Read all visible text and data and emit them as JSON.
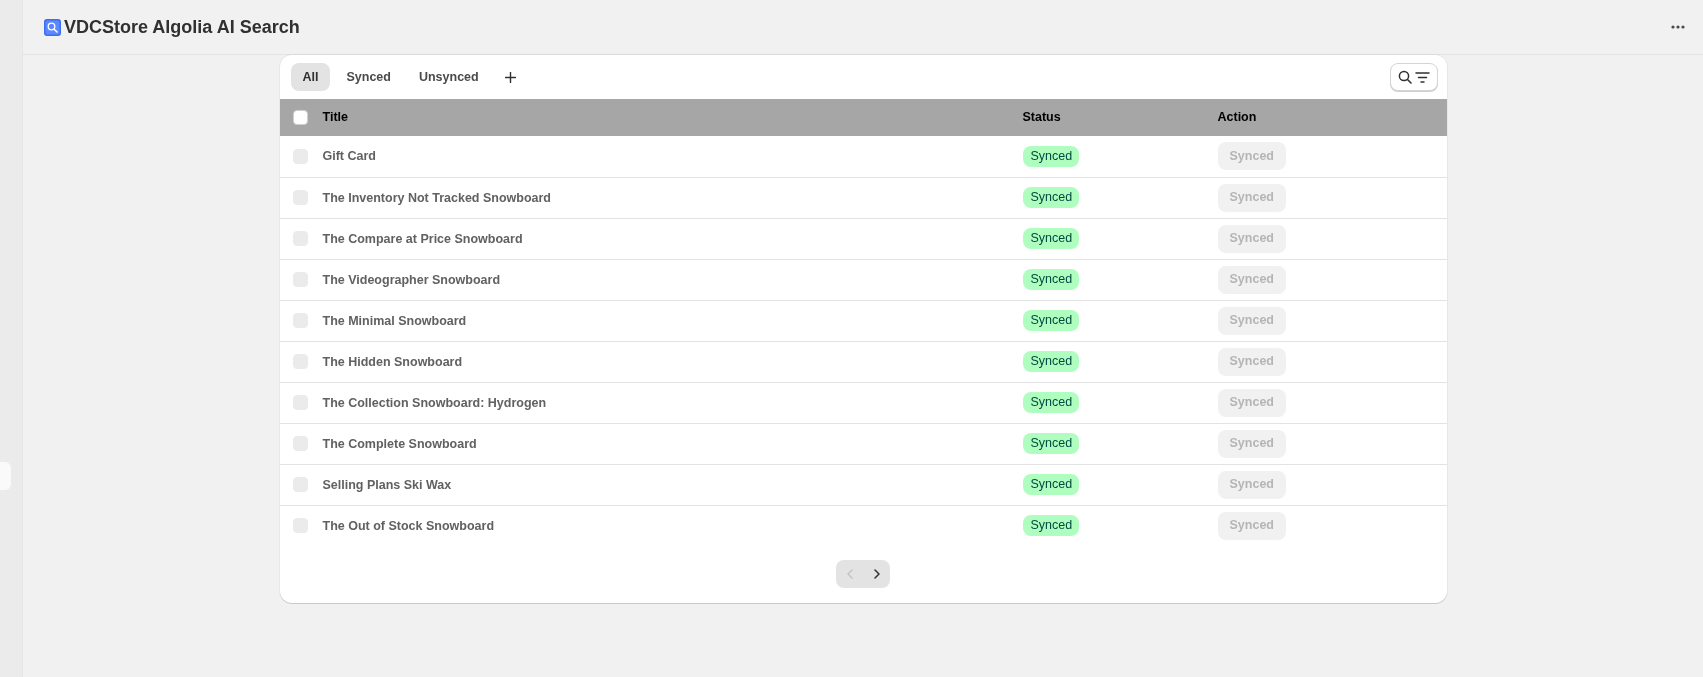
{
  "app": {
    "title": "VDCStore Algolia AI Search"
  },
  "tabs": [
    {
      "label": "All",
      "selected": true
    },
    {
      "label": "Synced",
      "selected": false
    },
    {
      "label": "Unsynced",
      "selected": false
    }
  ],
  "table": {
    "select_all": {
      "checked": false
    },
    "columns": [
      "Title",
      "Status",
      "Action"
    ],
    "rows": [
      {
        "checkbox": {
          "checked": false,
          "disabled": true
        },
        "title": "Gift Card",
        "status": "Synced",
        "action": {
          "label": "Synced",
          "disabled": true
        }
      },
      {
        "checkbox": {
          "checked": false,
          "disabled": true
        },
        "title": "The Inventory Not Tracked Snowboard",
        "status": "Synced",
        "action": {
          "label": "Synced",
          "disabled": true
        }
      },
      {
        "checkbox": {
          "checked": false,
          "disabled": true
        },
        "title": "The Compare at Price Snowboard",
        "status": "Synced",
        "action": {
          "label": "Synced",
          "disabled": true
        }
      },
      {
        "checkbox": {
          "checked": false,
          "disabled": true
        },
        "title": "The Videographer Snowboard",
        "status": "Synced",
        "action": {
          "label": "Synced",
          "disabled": true
        }
      },
      {
        "checkbox": {
          "checked": false,
          "disabled": true
        },
        "title": "The Minimal Snowboard",
        "status": "Synced",
        "action": {
          "label": "Synced",
          "disabled": true
        }
      },
      {
        "checkbox": {
          "checked": false,
          "disabled": true
        },
        "title": "The Hidden Snowboard",
        "status": "Synced",
        "action": {
          "label": "Synced",
          "disabled": true
        }
      },
      {
        "checkbox": {
          "checked": false,
          "disabled": true
        },
        "title": "The Collection Snowboard: Hydrogen",
        "status": "Synced",
        "action": {
          "label": "Synced",
          "disabled": true
        }
      },
      {
        "checkbox": {
          "checked": false,
          "disabled": true
        },
        "title": "The Complete Snowboard",
        "status": "Synced",
        "action": {
          "label": "Synced",
          "disabled": true
        }
      },
      {
        "checkbox": {
          "checked": false,
          "disabled": true
        },
        "title": "Selling Plans Ski Wax",
        "status": "Synced",
        "action": {
          "label": "Synced",
          "disabled": true
        }
      },
      {
        "checkbox": {
          "checked": false,
          "disabled": true
        },
        "title": "The Out of Stock Snowboard",
        "status": "Synced",
        "action": {
          "label": "Synced",
          "disabled": true
        }
      }
    ]
  },
  "pagination": {
    "previous": {
      "disabled": true
    },
    "next": {
      "disabled": false
    }
  }
}
